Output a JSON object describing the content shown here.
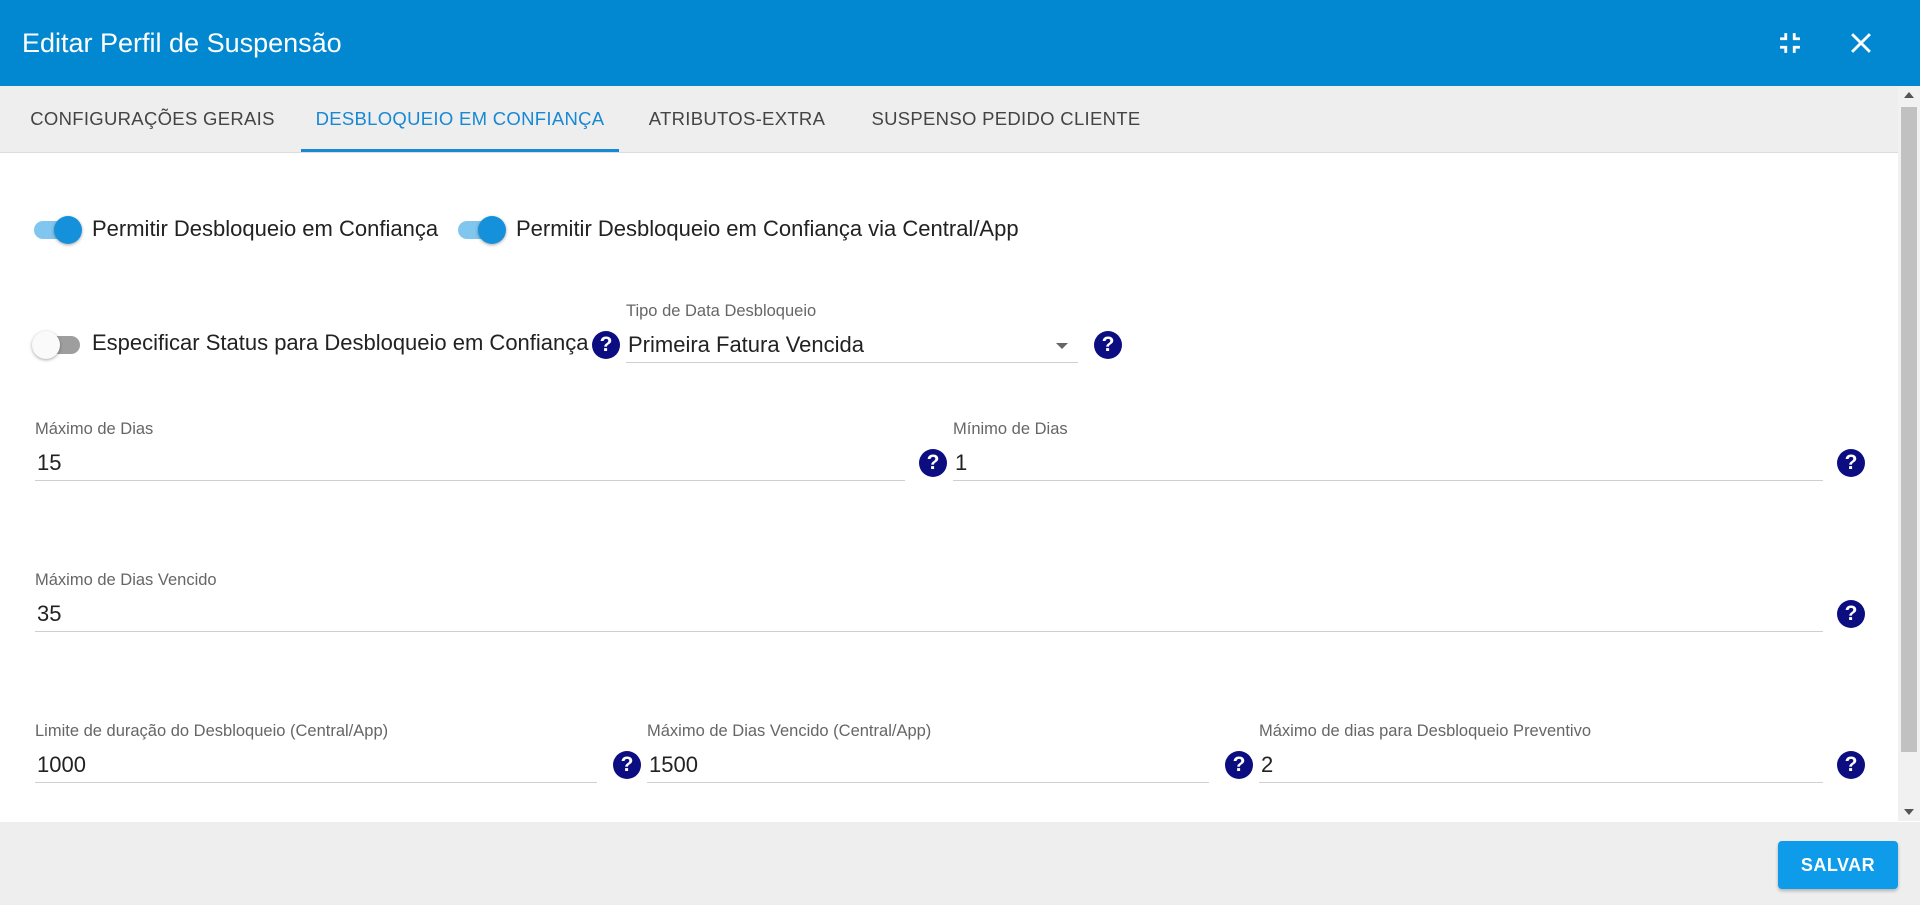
{
  "dialog": {
    "title": "Editar Perfil de Suspensão"
  },
  "header_icons": {
    "minimize": "fullscreen-exit-icon",
    "close": "close-icon"
  },
  "tabs": [
    {
      "label": "CONFIGURAÇÕES GERAIS",
      "active": false
    },
    {
      "label": "DESBLOQUEIO EM CONFIANÇA",
      "active": true
    },
    {
      "label": "ATRIBUTOS-EXTRA",
      "active": false
    },
    {
      "label": "SUSPENSO PEDIDO CLIENTE",
      "active": false
    }
  ],
  "toggles": {
    "permitir": {
      "label": "Permitir Desbloqueio em Confiança",
      "on": true
    },
    "permitir_central": {
      "label": "Permitir Desbloqueio em Confiança via Central/App",
      "on": true
    },
    "especificar_status": {
      "label": "Especificar Status para Desbloqueio em Confiança",
      "on": false
    }
  },
  "fields": {
    "tipo_data": {
      "label": "Tipo de Data Desbloqueio",
      "value": "Primeira Fatura Vencida"
    },
    "maximo_dias": {
      "label": "Máximo de Dias",
      "value": "15"
    },
    "minimo_dias": {
      "label": "Mínimo de Dias",
      "value": "1"
    },
    "maximo_dias_vencido": {
      "label": "Máximo de Dias Vencido",
      "value": "35"
    },
    "limite_duracao": {
      "label": "Limite de duração do Desbloqueio (Central/App)",
      "value": "1000"
    },
    "maximo_dias_vencido_central": {
      "label": "Máximo de Dias Vencido (Central/App)",
      "value": "1500"
    },
    "maximo_dias_preventivo": {
      "label": "Máximo de dias para Desbloqueio Preventivo",
      "value": "2"
    }
  },
  "help_symbol": "?",
  "footer": {
    "save_label": "SALVAR"
  },
  "colors": {
    "header": "#0288d1",
    "accent": "#1789d4",
    "help": "#0d0d82",
    "save": "#0d9bea"
  }
}
